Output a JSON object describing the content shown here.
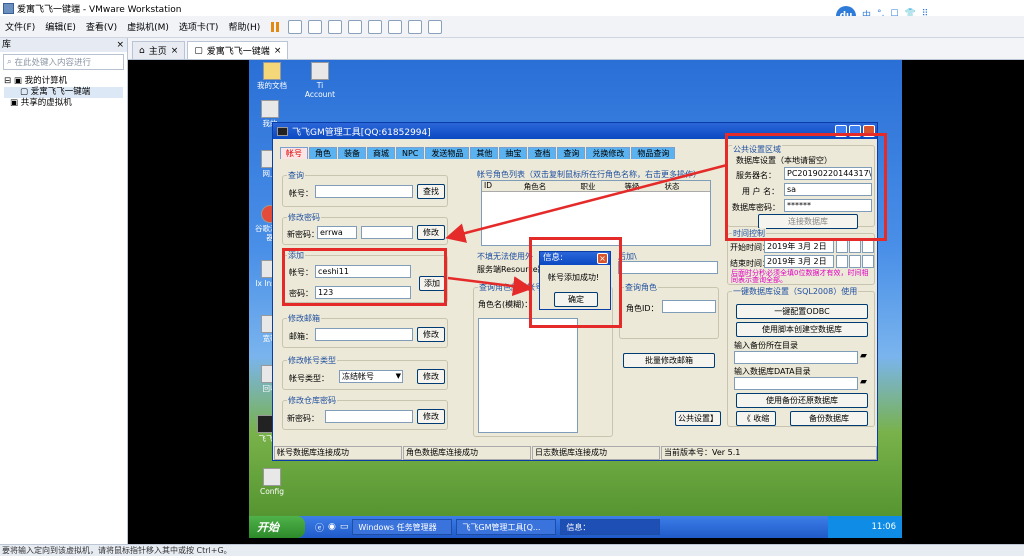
{
  "window_title": "爱寓飞飞一键端 - VMware Workstation",
  "ime": {
    "logo": "du",
    "items": [
      "中",
      "°,",
      "☐",
      "👕",
      "⠿"
    ]
  },
  "menu": [
    "文件(F)",
    "编辑(E)",
    "查看(V)",
    "虚拟机(M)",
    "选项卡(T)",
    "帮助(H)"
  ],
  "library": {
    "title": "库",
    "close": "×",
    "search_placeholder": "在此处键入内容进行",
    "tree": {
      "root": "我的计算机",
      "vm": "爱寓飞飞一键端",
      "shared": "共享的虚拟机"
    }
  },
  "tabs": [
    {
      "label": "主页",
      "close": "×"
    },
    {
      "label": "爱寓飞飞一键端",
      "close": "×"
    }
  ],
  "desktop_icons": [
    "我的文档",
    "Ti Account",
    "我的",
    "网上",
    "谷歌浏览器",
    "Ix Instal",
    "宽带",
    "回收",
    "飞飞",
    "Config"
  ],
  "taskbar": {
    "start": "开始",
    "items": [
      "Windows 任务管理器",
      "飞飞GM管理工具[Q...",
      "信息："
    ],
    "clock": "11:06"
  },
  "status_bar": "要将输入定向到该虚拟机，请将鼠标指针移入其中或按 Ctrl+G。",
  "app": {
    "title": "飞飞GM管理工具[QQ:61852994]",
    "tabs": [
      "帐号",
      "角色",
      "装备",
      "商城",
      "NPC",
      "发送物品",
      "其他",
      "抽宝",
      "查档",
      "查询",
      "兑换修改",
      "物品查询"
    ],
    "query": {
      "title": "查询",
      "account_label": "帐号：",
      "button": "查找"
    },
    "modify_password": {
      "title": "修改密码",
      "label": "新密码：",
      "value": "errwa",
      "button": "修改"
    },
    "add": {
      "title": "添加",
      "account_label": "帐号：",
      "account_value": "ceshi11",
      "password_label": "密码：",
      "password_value": "123",
      "button": "添加"
    },
    "modify_email": {
      "title": "修改邮箱",
      "label": "邮箱：",
      "button": "修改"
    },
    "modify_type": {
      "title": "修改帐号类型",
      "label": "帐号类型：",
      "value": "冻结帐号",
      "button": "修改"
    },
    "modify_vault": {
      "title": "修改仓库密码",
      "label": "新密码：",
      "button": "修改"
    },
    "role_list": {
      "title": "帐号角色列表（双击复制鼠标所在行角色名称，右击更多操作）",
      "columns": [
        "ID",
        "角色名",
        "职业",
        "等级",
        "状态"
      ]
    },
    "unusable_title": "不填无法使用外",
    "server_path": {
      "label": "服务端Resource路",
      "suffix": "后加\\"
    },
    "query_char": {
      "title": "查询角色所属帐号",
      "label": "角色名(模糊)："
    },
    "query_role": {
      "title": "查询角色",
      "label": "角色ID："
    },
    "batch_email_button": "批量修改邮箱",
    "public_settings_button": "公共设置】",
    "public": {
      "title": "公共设置区域",
      "db_title": "数据库设置（本地请留空）",
      "server_label": "服务器名：",
      "server_value": "PC20190220144317\\S",
      "user_label": "用 户 名：",
      "user_value": "sa",
      "pwd_label": "数据库密码：",
      "pwd_value": "******",
      "connect_button": "连接数据库"
    },
    "time": {
      "title": "时间控制",
      "start_label": "开始时间：",
      "start_value": "2019年 3月 2日",
      "end_label": "结束时间：",
      "end_value": "2019年 3月 2日",
      "note": "后面时分秒必须全填0位数据才有效，时间相同表示查询全部。"
    },
    "db_tools": {
      "title": "一键数据库设置（SQL2008）使用",
      "odbc_button": "一键配置ODBC",
      "script_button": "使用脚本创建空数据库",
      "backup_dir_label": "输入备份所在目录",
      "data_dir_label": "输入数据库DATA目录",
      "restore_button": "使用备份还原数据库",
      "collapse_button": "《 收缩",
      "backup_button": "备份数据库"
    },
    "status": [
      "帐号数据库连接成功",
      "角色数据库连接成功",
      "日志数据库连接成功",
      "当前版本号：Ver 5.1"
    ]
  },
  "dialog": {
    "title": "信息:",
    "message": "帐号添加成功!",
    "button": "确定"
  },
  "colors": {
    "highlight": "#e52a2a",
    "xp_blue": "#0b49c2",
    "tab_blue": "#5ab2f0"
  }
}
